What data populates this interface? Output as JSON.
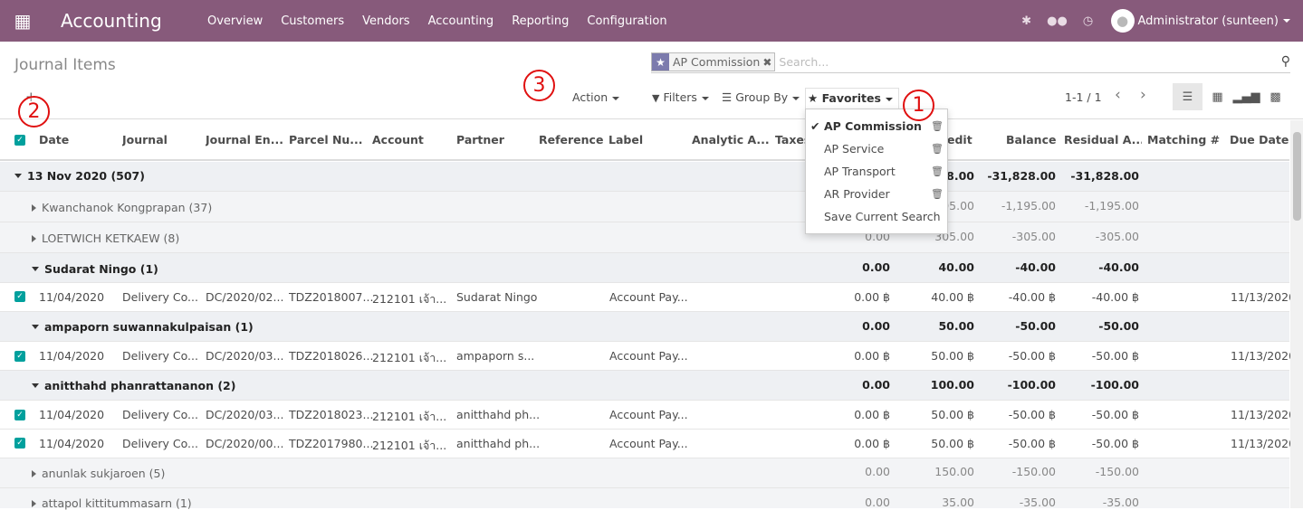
{
  "navbar": {
    "app_name": "Accounting",
    "menu": [
      "Overview",
      "Customers",
      "Vendors",
      "Accounting",
      "Reporting",
      "Configuration"
    ],
    "user": "Administrator (sunteen)"
  },
  "breadcrumb": "Journal Items",
  "search": {
    "facet": "AP Commission",
    "placeholder": "Search..."
  },
  "toolbar": {
    "action": "Action",
    "filters": "Filters",
    "group_by": "Group By",
    "favorites": "Favorites"
  },
  "pager": "1-1 / 1",
  "favorites_menu": [
    "AP Commission",
    "AP Service",
    "AP Transport",
    "AR Provider",
    "Save Current Search"
  ],
  "columns": [
    "Date",
    "Journal",
    "Journal En...",
    "Parcel Nu...",
    "Account",
    "Partner",
    "Reference",
    "Label",
    "Analytic A...",
    "Taxes",
    "Debit",
    "Credit",
    "Balance",
    "Residual A...",
    "Matching #",
    "Due Date"
  ],
  "columns_visible": {
    "credit": "edit"
  },
  "groups": {
    "g1": {
      "label": "13 Nov 2020 (507)",
      "credit": "31,828.00",
      "balance": "-31,828.00",
      "residual": "-31,828.00"
    },
    "s1": {
      "label": "Kwanchanok Kongprapan (37)",
      "credit": "1,195.00",
      "balance": "-1,195.00",
      "residual": "-1,195.00"
    },
    "s2": {
      "label": "LOETWICH KETKAEW (8)",
      "debit": "0.00",
      "credit": "305.00",
      "balance": "-305.00",
      "residual": "-305.00"
    },
    "s3": {
      "label": "Sudarat Ningo (1)",
      "debit": "0.00",
      "credit": "40.00",
      "balance": "-40.00",
      "residual": "-40.00"
    },
    "s4": {
      "label": "ampaporn suwannakulpaisan (1)",
      "debit": "0.00",
      "credit": "50.00",
      "balance": "-50.00",
      "residual": "-50.00"
    },
    "s5": {
      "label": "anitthahd phanrattananon (2)",
      "debit": "0.00",
      "credit": "100.00",
      "balance": "-100.00",
      "residual": "-100.00"
    },
    "s6": {
      "label": "anunlak sukjaroen (5)",
      "debit": "0.00",
      "credit": "150.00",
      "balance": "-150.00",
      "residual": "-150.00"
    },
    "s7": {
      "label": "attapol kittitummasarn (1)",
      "debit": "0.00",
      "credit": "35.00",
      "balance": "-35.00",
      "residual": "-35.00"
    }
  },
  "rows": [
    {
      "date": "11/04/2020",
      "journal": "Delivery Co...",
      "entry": "DC/2020/02...",
      "parcel": "TDZ2018007...",
      "account": "212101 เจ้า...",
      "partner": "Sudarat Ningo",
      "label": "Account Pay...",
      "debit": "0.00 ฿",
      "credit": "40.00 ฿",
      "balance": "-40.00 ฿",
      "residual": "-40.00 ฿",
      "due": "11/13/2020"
    },
    {
      "date": "11/04/2020",
      "journal": "Delivery Co...",
      "entry": "DC/2020/03...",
      "parcel": "TDZ2018026...",
      "account": "212101 เจ้า...",
      "partner": "ampaporn s...",
      "label": "Account Pay...",
      "debit": "0.00 ฿",
      "credit": "50.00 ฿",
      "balance": "-50.00 ฿",
      "residual": "-50.00 ฿",
      "due": "11/13/2020"
    },
    {
      "date": "11/04/2020",
      "journal": "Delivery Co...",
      "entry": "DC/2020/03...",
      "parcel": "TDZ2018023...",
      "account": "212101 เจ้า...",
      "partner": "anitthahd ph...",
      "label": "Account Pay...",
      "debit": "0.00 ฿",
      "credit": "50.00 ฿",
      "balance": "-50.00 ฿",
      "residual": "-50.00 ฿",
      "due": "11/13/2020"
    },
    {
      "date": "11/04/2020",
      "journal": "Delivery Co...",
      "entry": "DC/2020/00...",
      "parcel": "TDZ2017980...",
      "account": "212101 เจ้า...",
      "partner": "anitthahd ph...",
      "label": "Account Pay...",
      "debit": "0.00 ฿",
      "credit": "50.00 ฿",
      "balance": "-50.00 ฿",
      "residual": "-50.00 ฿",
      "due": "11/13/2020"
    }
  ],
  "badges": [
    "1",
    "2",
    "3"
  ]
}
